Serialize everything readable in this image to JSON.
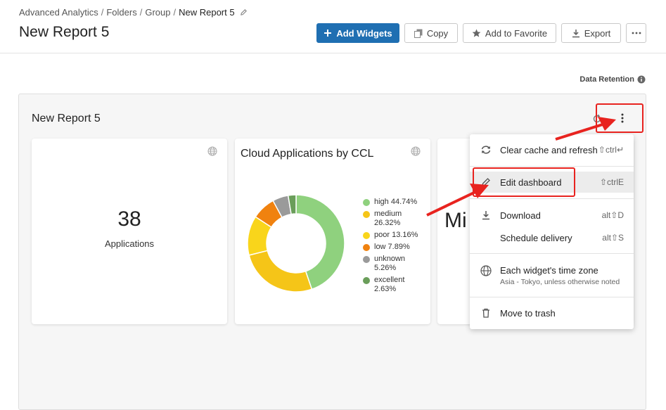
{
  "breadcrumb": {
    "items": [
      "Advanced Analytics",
      "Folders",
      "Group"
    ],
    "separator": "/",
    "current": "New Report 5"
  },
  "page_title": "New Report 5",
  "toolbar": {
    "add_widgets_label": "Add Widgets",
    "copy_label": "Copy",
    "favorite_label": "Add to Favorite",
    "export_label": "Export"
  },
  "data_retention_label": "Data Retention",
  "dashboard": {
    "title": "New Report 5",
    "widgets": {
      "applications": {
        "value": "38",
        "label": "Applications"
      },
      "cloud_apps": {
        "title": "Cloud Applications by CCL",
        "legend": [
          {
            "label": "high 44.74%",
            "color": "#8fd17e"
          },
          {
            "label": "medium",
            "label2": "26.32%",
            "color": "#f5c518"
          },
          {
            "label": "poor 13.16%",
            "color": "#f9d51b"
          },
          {
            "label": "low 7.89%",
            "color": "#f0820f"
          },
          {
            "label": "unknown",
            "label2": "5.26%",
            "color": "#9a9a9a"
          },
          {
            "label": "excellent",
            "label2": "2.63%",
            "color": "#6a9e5a"
          }
        ]
      },
      "third_partial_text": "Mi"
    }
  },
  "chart_data": {
    "type": "pie",
    "title": "Cloud Applications by CCL",
    "donut": true,
    "categories": [
      "high",
      "medium",
      "poor",
      "low",
      "unknown",
      "excellent"
    ],
    "values": [
      44.74,
      26.32,
      13.16,
      7.89,
      5.26,
      2.63
    ],
    "colors": [
      "#8fd17e",
      "#f5c518",
      "#f9d51b",
      "#f0820f",
      "#9a9a9a",
      "#6a9e5a"
    ],
    "legend": "right"
  },
  "menu": {
    "clear_cache": {
      "label": "Clear cache and refresh",
      "shortcut": "⇧ctrl↵"
    },
    "edit_dashboard": {
      "label": "Edit dashboard",
      "shortcut": "⇧ctrlE"
    },
    "download": {
      "label": "Download",
      "shortcut": "alt⇧D"
    },
    "schedule": {
      "label": "Schedule delivery",
      "shortcut": "alt⇧S"
    },
    "timezone": {
      "label": "Each widget's time zone",
      "sub": "Asia - Tokyo, unless otherwise noted"
    },
    "trash": {
      "label": "Move to trash"
    }
  },
  "colors": {
    "primary": "#1f6fb2",
    "annotation": "#e8231f",
    "panel_bg": "#f6f6f6"
  }
}
